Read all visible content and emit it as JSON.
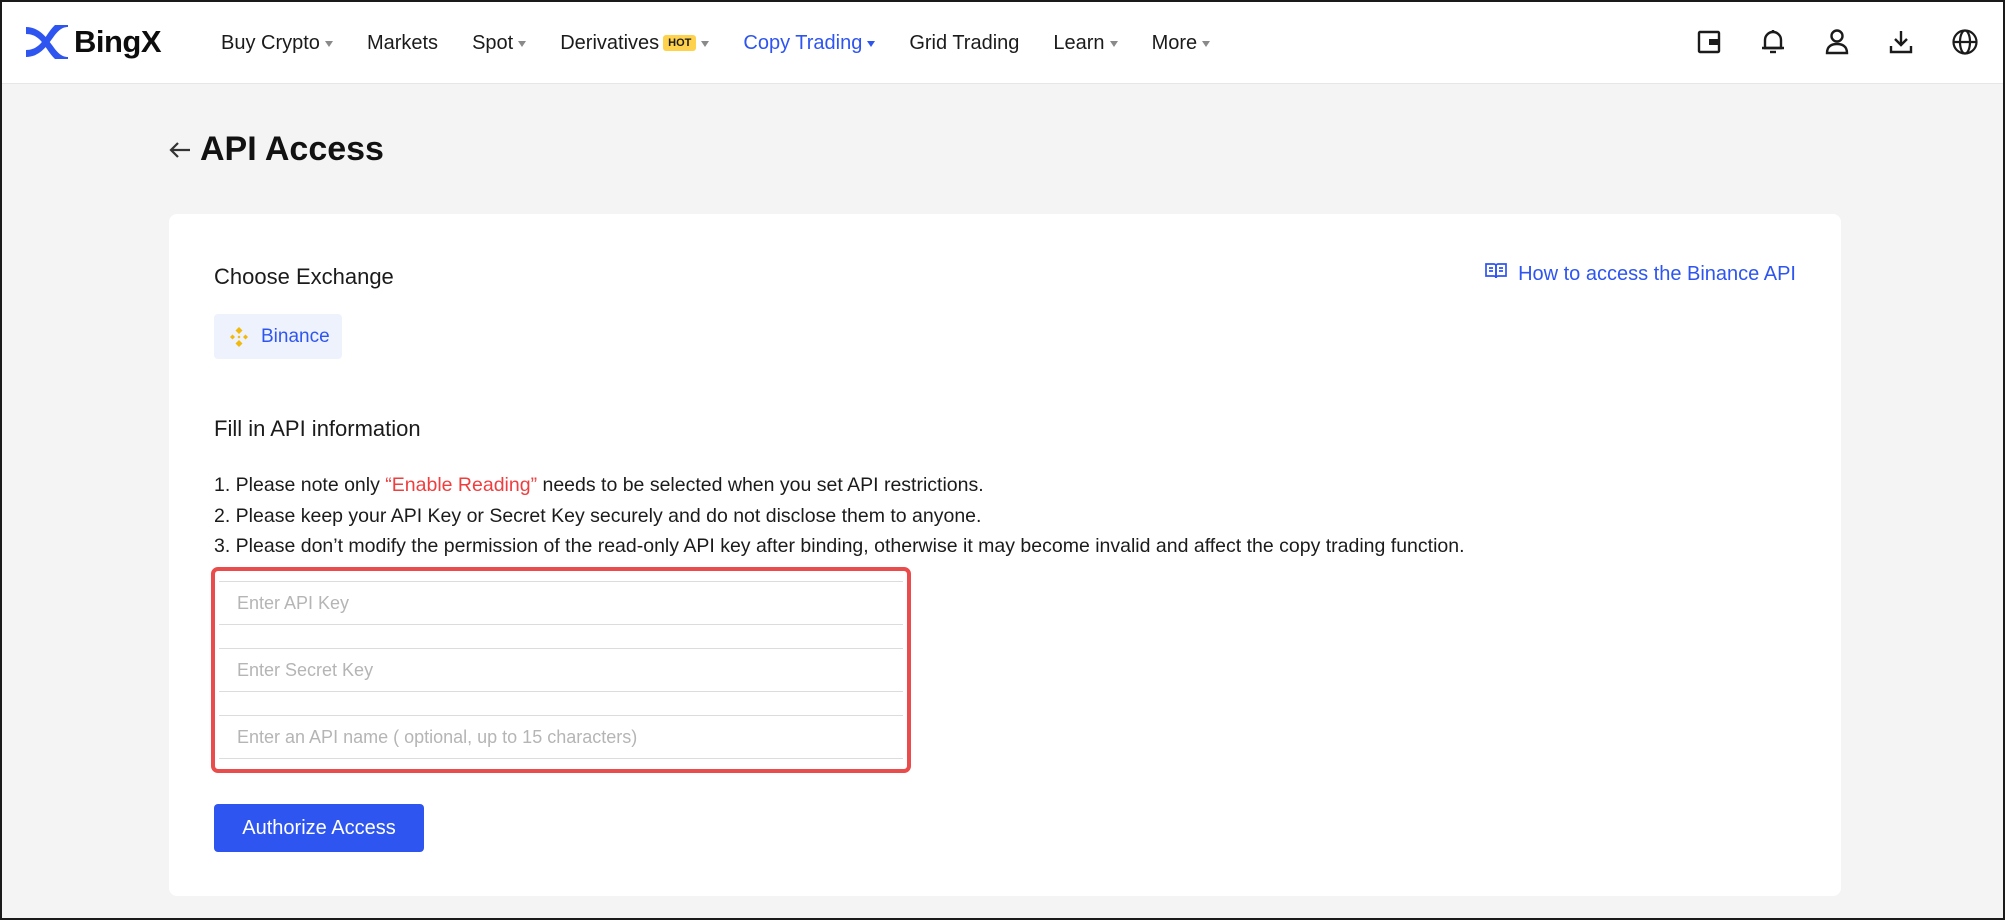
{
  "brand": {
    "name": "BingX",
    "logo_color": "#2e55f0"
  },
  "nav": {
    "items": [
      {
        "label": "Buy Crypto",
        "has_caret": true
      },
      {
        "label": "Markets",
        "has_caret": false
      },
      {
        "label": "Spot",
        "has_caret": true
      },
      {
        "label": "Derivatives",
        "badge": "HOT",
        "has_caret": true
      },
      {
        "label": "Copy Trading",
        "has_caret": true,
        "active": true
      },
      {
        "label": "Grid Trading",
        "has_caret": false
      },
      {
        "label": "Learn",
        "has_caret": true
      },
      {
        "label": "More",
        "has_caret": true
      }
    ],
    "active_color": "#2e55f0"
  },
  "header_icons": [
    "wallet-icon",
    "bell-icon",
    "user-icon",
    "download-icon",
    "globe-icon"
  ],
  "page": {
    "title": "API Access"
  },
  "exchange": {
    "heading": "Choose Exchange",
    "selected": "Binance",
    "help_link": "How to access the Binance API"
  },
  "api_info": {
    "heading": "Fill in API information",
    "notes": {
      "n1_prefix": "1. Please note only ",
      "n1_highlight": "“Enable Reading”",
      "n1_suffix": " needs to be selected when you set API restrictions.",
      "n2": "2. Please keep your API Key or Secret Key securely and do not disclose them to anyone.",
      "n3": "3. Please don’t modify the permission of the read-only API key after binding, otherwise it may become invalid and affect the copy trading function."
    },
    "highlight_color": "#ef3e3e",
    "fields": {
      "api_key_placeholder": "Enter API Key",
      "secret_key_placeholder": "Enter Secret Key",
      "api_name_placeholder": "Enter an API name ( optional, up to 15 characters)"
    }
  },
  "actions": {
    "authorize_label": "Authorize Access"
  }
}
